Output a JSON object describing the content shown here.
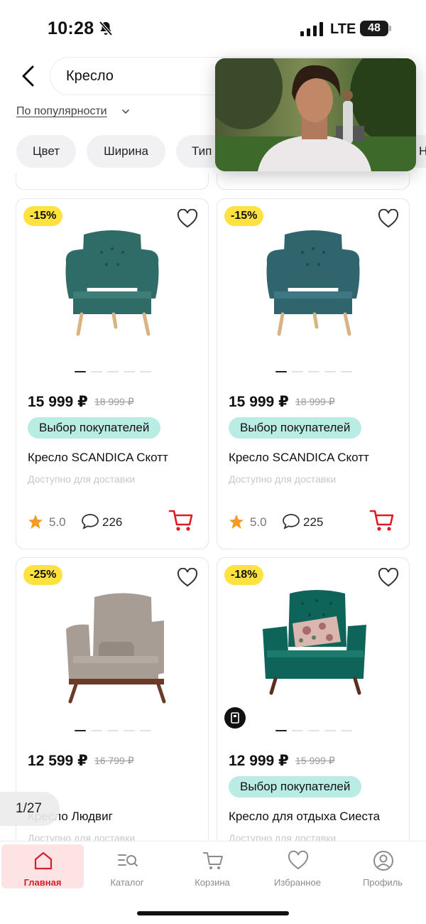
{
  "status_bar": {
    "time": "10:28",
    "network": "LTE",
    "battery": "48"
  },
  "search": {
    "query": "Кресло"
  },
  "sort": {
    "label": "По популярности"
  },
  "filters": [
    "Цвет",
    "Ширина",
    "Тип",
    "Ни"
  ],
  "products": [
    {
      "badge": "-15%",
      "price": "15 999 ₽",
      "old_price": "18 999 ₽",
      "choice": "Выбор покупателей",
      "name": "Кресло SCANDICA Скотт",
      "availability": "Доступно для доставки",
      "rating": "5.0",
      "reviews": "226",
      "color": "#2f6b67"
    },
    {
      "badge": "-15%",
      "price": "15 999 ₽",
      "old_price": "18 999 ₽",
      "choice": "Выбор покупателей",
      "name": "Кресло SCANDICA Скотт",
      "availability": "Доступно для доставки",
      "rating": "5.0",
      "reviews": "225",
      "color": "#31656e"
    },
    {
      "badge": "-25%",
      "price": "12 599 ₽",
      "old_price": "16 799 ₽",
      "choice": "",
      "name": "Кресло Людвиг",
      "availability": "Доступно для доставки",
      "rating": "",
      "reviews": "",
      "color": "#a79d95"
    },
    {
      "badge": "-18%",
      "price": "12 999 ₽",
      "old_price": "15 999 ₽",
      "choice": "Выбор покупателей",
      "name": "Кресло для отдыха Сиеста",
      "availability": "Доступно для доставки",
      "rating": "",
      "reviews": "",
      "color": "#0f6459"
    }
  ],
  "pager": {
    "label": "1/27"
  },
  "tabbar": [
    {
      "label": "Главная",
      "active": true,
      "icon": "home-icon"
    },
    {
      "label": "Каталог",
      "active": false,
      "icon": "catalog-search-icon"
    },
    {
      "label": "Корзина",
      "active": false,
      "icon": "cart-icon"
    },
    {
      "label": "Избранное",
      "active": false,
      "icon": "heart-icon"
    },
    {
      "label": "Профиль",
      "active": false,
      "icon": "profile-icon"
    }
  ],
  "colors": {
    "accent": "#d61f2c",
    "badge": "#ffe23f",
    "choice": "#b9ece3",
    "star": "#f59a23"
  }
}
